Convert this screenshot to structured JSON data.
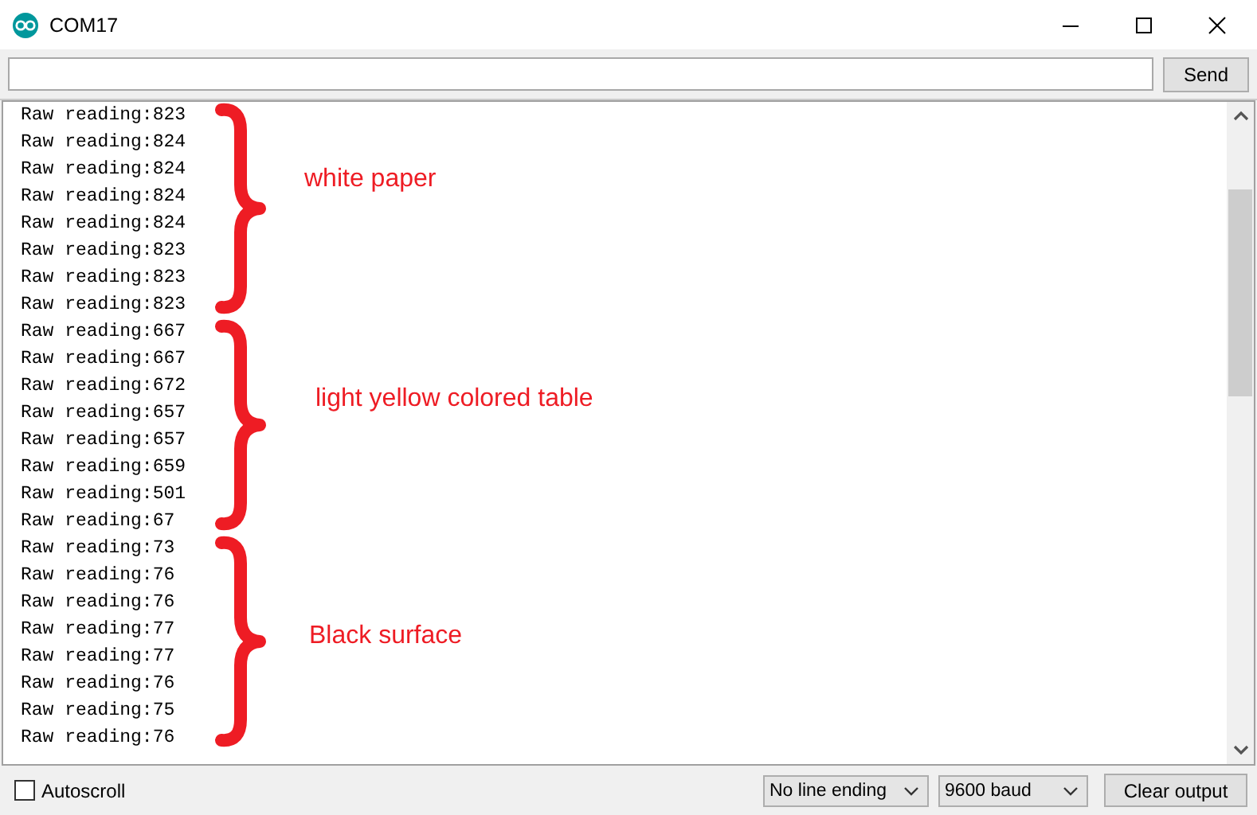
{
  "window": {
    "title": "COM17"
  },
  "input": {
    "button": "Send"
  },
  "output": {
    "groups": [
      {
        "annotation": "white paper",
        "lines": [
          "Raw reading:823",
          "Raw reading:824",
          "Raw reading:824",
          "Raw reading:824",
          "Raw reading:824",
          "Raw reading:823",
          "Raw reading:823",
          "Raw reading:823"
        ]
      },
      {
        "annotation": "light yellow colored table",
        "lines": [
          "Raw reading:667",
          "Raw reading:667",
          "Raw reading:672",
          "Raw reading:657",
          "Raw reading:657",
          "Raw reading:659",
          "Raw reading:501",
          "Raw reading:67"
        ]
      },
      {
        "annotation": "Black surface",
        "lines": [
          "Raw reading:73",
          "Raw reading:76",
          "Raw reading:76",
          "Raw reading:77",
          "Raw reading:77",
          "Raw reading:76",
          "Raw reading:75",
          "Raw reading:76"
        ]
      }
    ]
  },
  "status_bar": {
    "autoscroll": {
      "label": "Autoscroll",
      "checked": false
    },
    "line_ending": "No line ending",
    "baud": "9600 baud",
    "clear_button": "Clear output"
  }
}
